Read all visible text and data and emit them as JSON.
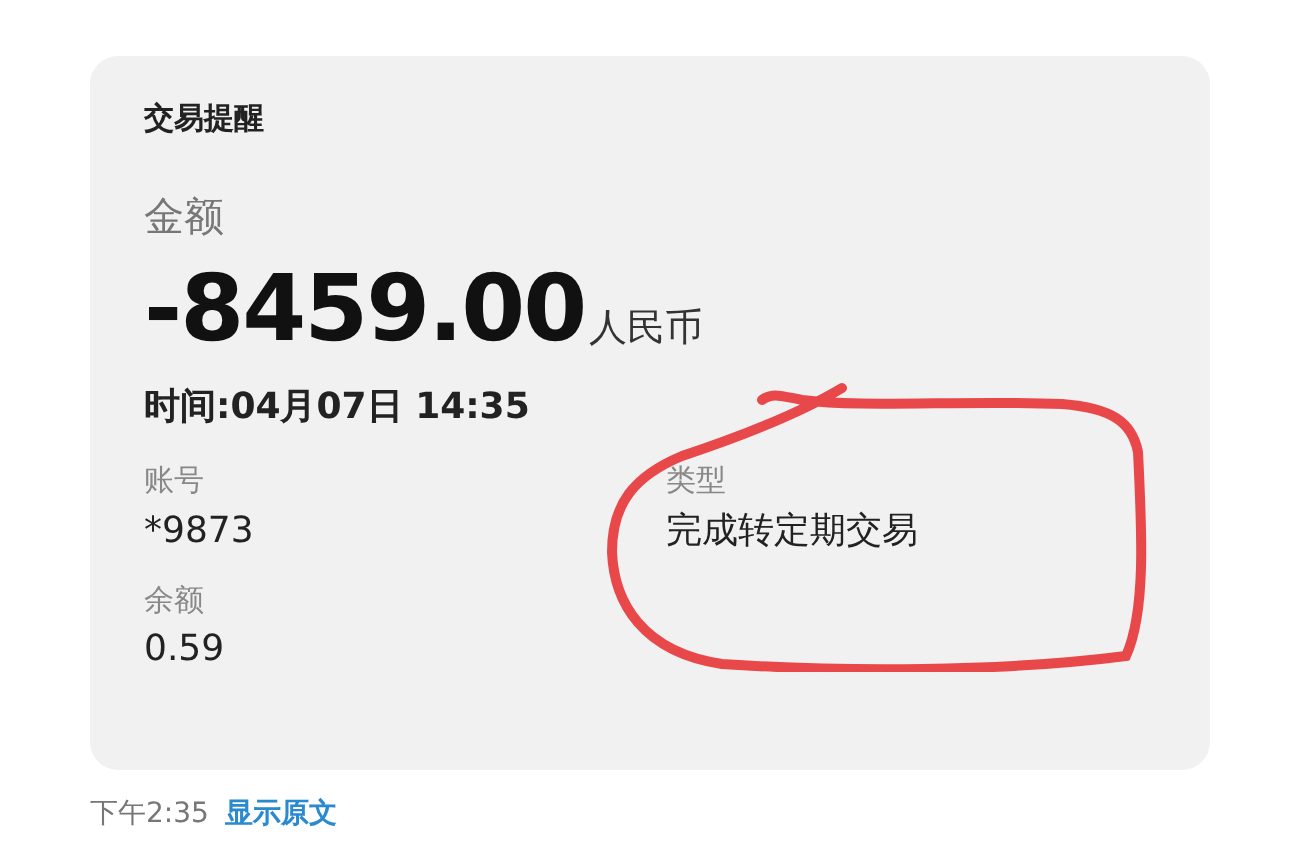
{
  "card": {
    "title": "交易提醒",
    "amount_label": "金额",
    "amount": "-8459.00",
    "currency": "人民币",
    "time": "时间:04月07日 14:35",
    "fields": [
      {
        "label": "账号",
        "value": "*9873"
      },
      {
        "label": "类型",
        "value": "完成转定期交易"
      },
      {
        "label": "余额",
        "value": "0.59"
      }
    ]
  },
  "footer": {
    "time": "下午2:35",
    "link": "显示原文"
  }
}
